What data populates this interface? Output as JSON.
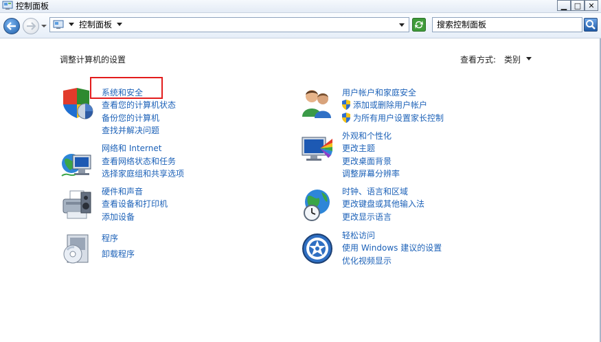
{
  "window": {
    "title": "控制面板",
    "buttons": {
      "minimize": "▁",
      "maximize": "□",
      "close": "✕"
    }
  },
  "address": {
    "path": "控制面板",
    "search_placeholder": "搜索控制面板"
  },
  "main": {
    "heading": "调整计算机的设置",
    "view_label": "查看方式:",
    "view_value": "类别"
  },
  "left_categories": [
    {
      "title": "系统和安全",
      "icon": "security-shield-icon",
      "links": [
        "查看您的计算机状态",
        "备份您的计算机",
        "查找并解决问题"
      ]
    },
    {
      "title": "网络和 Internet",
      "icon": "network-globe-icon",
      "links": [
        "查看网络状态和任务",
        "选择家庭组和共享选项"
      ]
    },
    {
      "title": "硬件和声音",
      "icon": "printer-icon",
      "links": [
        "查看设备和打印机",
        "添加设备"
      ]
    },
    {
      "title": "程序",
      "icon": "programs-disc-icon",
      "links": [
        "卸载程序"
      ]
    }
  ],
  "right_categories": [
    {
      "title": "用户帐户和家庭安全",
      "icon": "users-icon",
      "links": [
        "添加或删除用户帐户",
        "为所有用户设置家长控制"
      ]
    },
    {
      "title": "外观和个性化",
      "icon": "monitor-palette-icon",
      "links": [
        "更改主题",
        "更改桌面背景",
        "调整屏幕分辨率"
      ]
    },
    {
      "title": "时钟、语言和区域",
      "icon": "clock-globe-icon",
      "links": [
        "更改键盘或其他输入法",
        "更改显示语言"
      ]
    },
    {
      "title": "轻松访问",
      "icon": "ease-of-access-icon",
      "links": [
        "使用 Windows 建议的设置",
        "优化视频显示"
      ]
    }
  ],
  "colors": {
    "link": "#1d62b8",
    "highlight": "#e21b1b"
  }
}
